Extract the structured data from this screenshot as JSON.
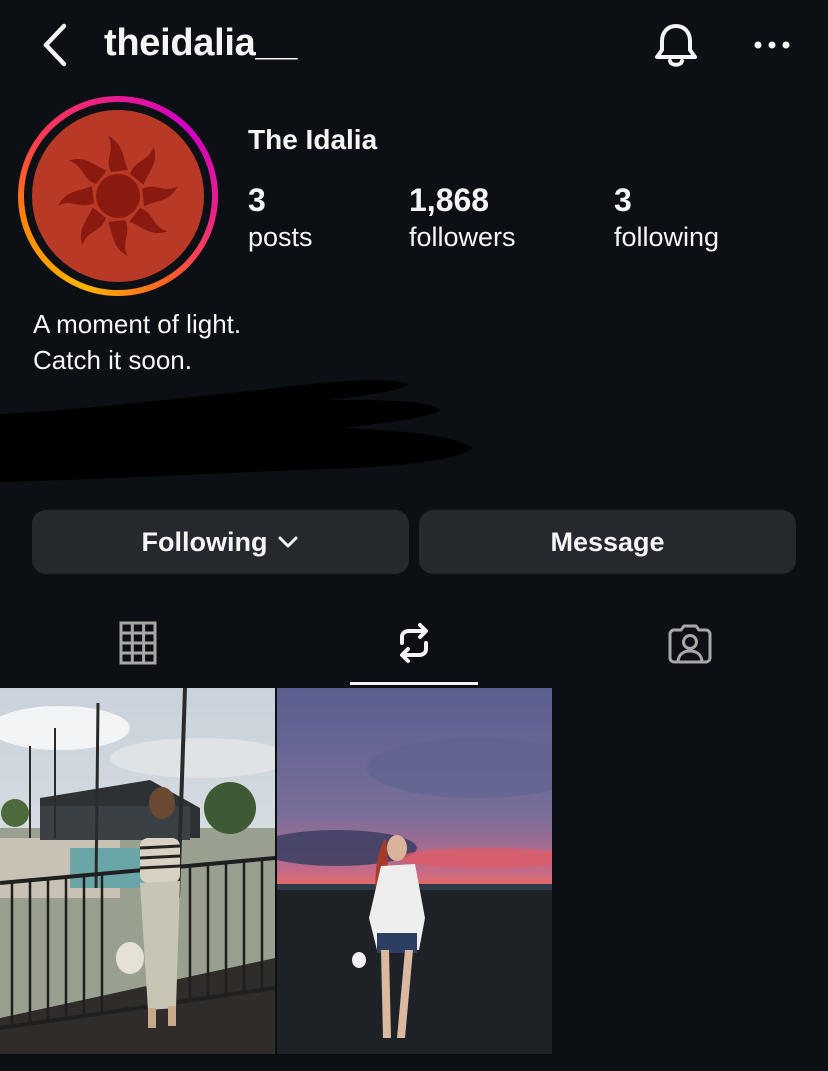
{
  "header": {
    "username": "theidalia__"
  },
  "profile": {
    "display_name": "The Idalia",
    "bio_lines": [
      "A moment of light.",
      "Catch it soon."
    ],
    "stats": {
      "posts": {
        "value": "3",
        "label": "posts"
      },
      "followers": {
        "value": "1,868",
        "label": "followers"
      },
      "following": {
        "value": "3",
        "label": "following"
      }
    }
  },
  "actions": {
    "following_label": "Following",
    "message_label": "Message"
  },
  "tabs": [
    {
      "icon": "grid-icon",
      "active": false
    },
    {
      "icon": "reposts-icon",
      "active": true
    },
    {
      "icon": "tagged-icon",
      "active": false
    }
  ],
  "posts": [
    {
      "image": "woman-on-balcony-photo"
    },
    {
      "image": "woman-at-sunset-beach-photo"
    }
  ],
  "colors": {
    "background": "#0c1014",
    "button": "#25292e",
    "avatar": "#b83a26",
    "sun": "#8a1a10"
  }
}
